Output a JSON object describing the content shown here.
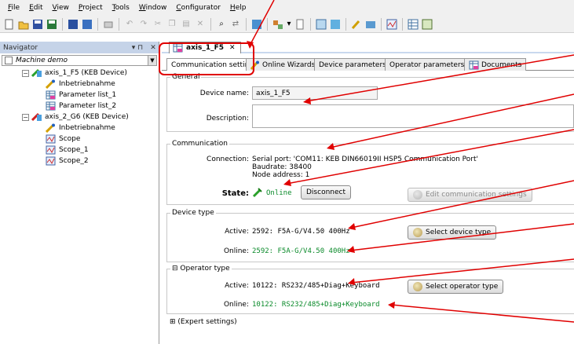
{
  "menu": [
    "File",
    "Edit",
    "View",
    "Project",
    "Tools",
    "Window",
    "Configurator",
    "Help"
  ],
  "navigator": {
    "title": "Navigator",
    "pin": "▾ ⊓",
    "close": "✕",
    "project": "Machine demo",
    "items": [
      "axis_1_F5 (KEB Device)",
      "Inbetriebnahme",
      "Parameter list_1",
      "Parameter list_2",
      "axis_2_G6 (KEB Device)",
      "Inbetriebnahme",
      "Scope",
      "Scope_1",
      "Scope_2"
    ]
  },
  "document_tab": "axis_1_F5",
  "inner_tabs": [
    "Communication settings",
    "Online Wizards",
    "Device parameters",
    "Operator parameters",
    "Documents"
  ],
  "general": {
    "title": "General",
    "device_name_label": "Device name:",
    "device_name": "axis_1_F5",
    "description_label": "Description:",
    "description": ""
  },
  "communication": {
    "title": "Communication",
    "connection_label": "Connection:",
    "serial_port": "Serial port: 'COM11: KEB DIN66019II HSP5 Communication Port'",
    "baudrate": "Baudrate: 38400",
    "node_address": "Node address: 1",
    "state_label": "State:",
    "state_value": "Online",
    "disconnect": "Disconnect",
    "edit_settings": "Edit communication settings"
  },
  "device_type": {
    "title": "Device type",
    "active_label": "Active:",
    "active_value": "2592: F5A-G/V4.50 400Hz",
    "online_label": "Online:",
    "online_value": "2592: F5A-G/V4.50 400Hz",
    "select_button": "Select device type"
  },
  "operator_type": {
    "title": "Operator type",
    "toggle": "⊟",
    "active_label": "Active:",
    "active_value": "10122: RS232/485+Diag+Keyboard",
    "online_label": "Online:",
    "online_value": "10122: RS232/485+Diag+Keyboard",
    "select_button": "Select operator type"
  },
  "expert": {
    "toggle": "⊞",
    "label": "(Expert settings)"
  },
  "colors": {
    "online_green": "#0a8a2a",
    "annotation_red": "#e00000",
    "nav_header": "#c5d3e8"
  }
}
